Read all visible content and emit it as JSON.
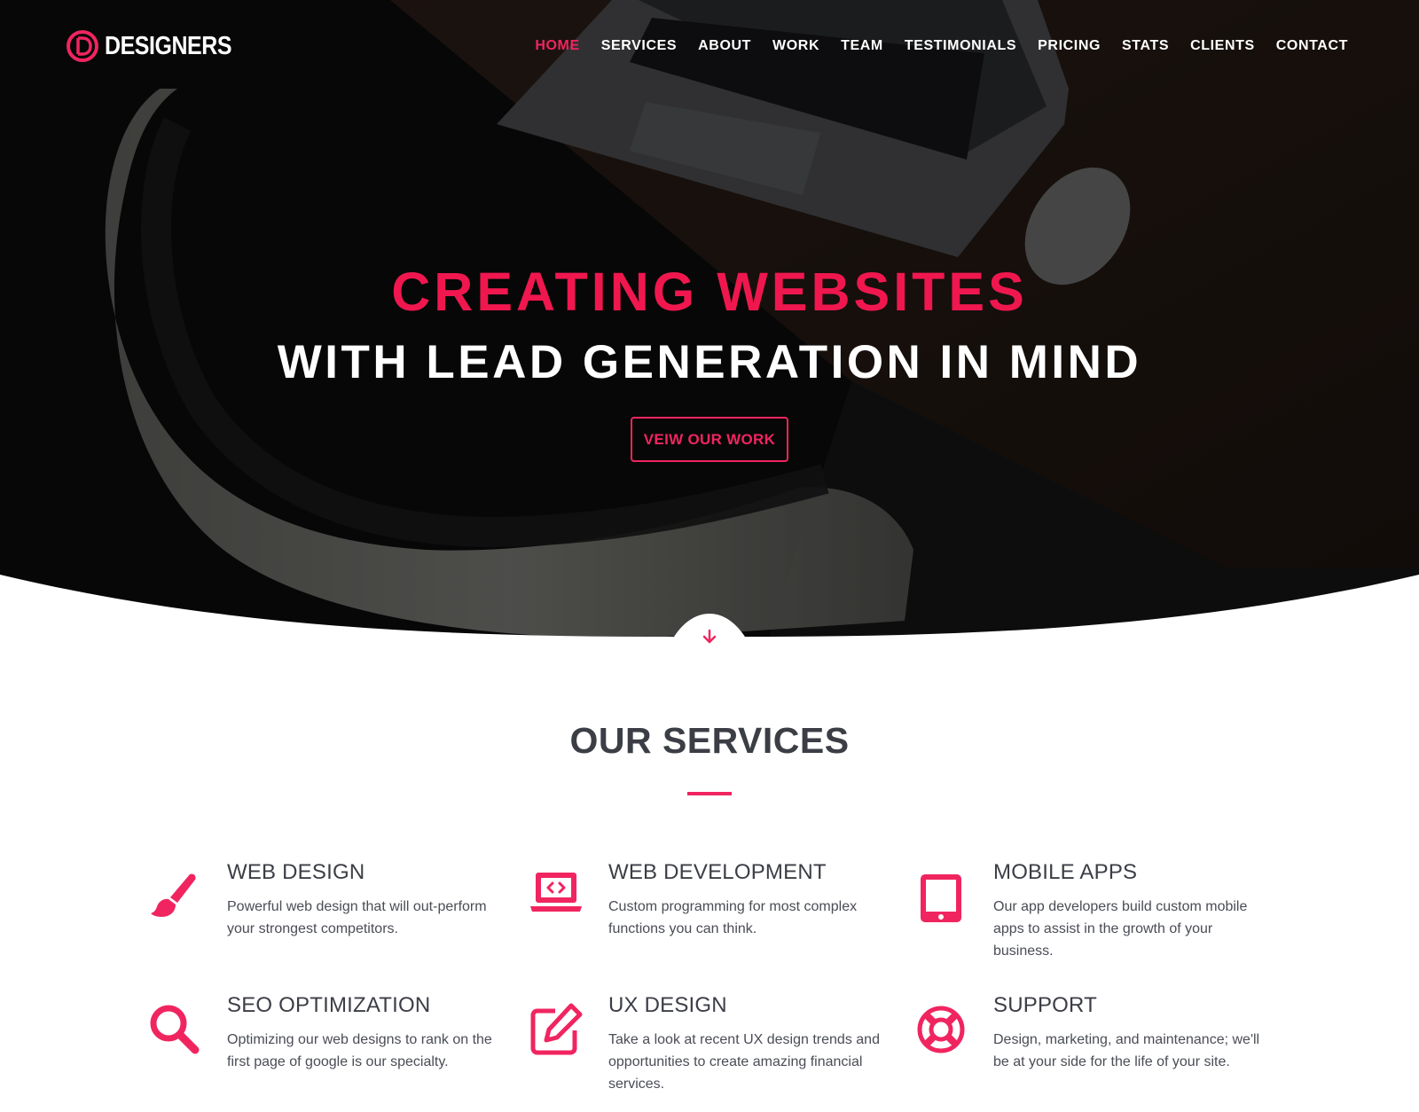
{
  "brand": {
    "name": "DESIGNERS",
    "accent": "#f02560"
  },
  "nav": {
    "items": [
      {
        "label": "HOME",
        "active": true
      },
      {
        "label": "SERVICES",
        "active": false
      },
      {
        "label": "ABOUT",
        "active": false
      },
      {
        "label": "WORK",
        "active": false
      },
      {
        "label": "TEAM",
        "active": false
      },
      {
        "label": "TESTIMONIALS",
        "active": false
      },
      {
        "label": "PRICING",
        "active": false
      },
      {
        "label": "STATS",
        "active": false
      },
      {
        "label": "CLIENTS",
        "active": false
      },
      {
        "label": "CONTACT",
        "active": false
      }
    ]
  },
  "hero": {
    "line1": "CREATING WEBSITES",
    "line2": "WITH LEAD GENERATION IN MIND",
    "cta": "VEIW OUR WORK",
    "scroll_icon": "arrow-down-icon"
  },
  "services": {
    "title": "OUR SERVICES",
    "items": [
      {
        "icon": "paintbrush-icon",
        "name": "WEB DESIGN",
        "desc": "Powerful web design that will out-perform your strongest competitors."
      },
      {
        "icon": "laptop-code-icon",
        "name": "WEB DEVELOPMENT",
        "desc": "Custom programming for most complex functions you can think."
      },
      {
        "icon": "tablet-icon",
        "name": "MOBILE APPS",
        "desc": "Our app developers build custom mobile apps to assist in the growth of your business."
      },
      {
        "icon": "search-icon",
        "name": "SEO OPTIMIZATION",
        "desc": "Optimizing our web designs to rank on the first page of google is our specialty."
      },
      {
        "icon": "edit-icon",
        "name": "UX DESIGN",
        "desc": "Take a look at recent UX design trends and opportunities to create amazing financial services."
      },
      {
        "icon": "lifebuoy-icon",
        "name": "SUPPORT",
        "desc": "Design, marketing, and maintenance; we'll be at your side for the life of your site."
      }
    ]
  }
}
